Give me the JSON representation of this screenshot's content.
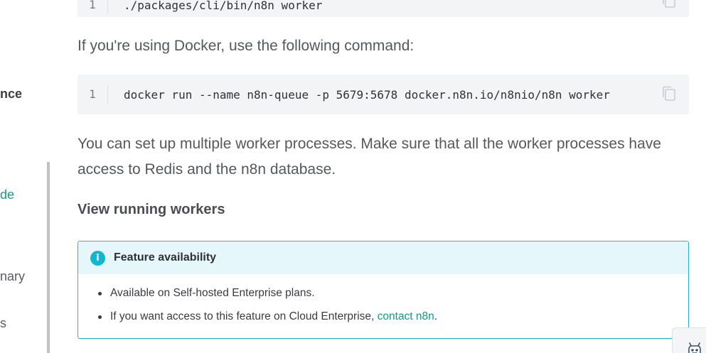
{
  "sidebar": {
    "frag_a": "nce",
    "frag_b": "de",
    "frag_c": "nary",
    "frag_d": "s"
  },
  "code_top": {
    "line_number": "1",
    "text": "./packages/cli/bin/n8n worker"
  },
  "docker_intro": "If you're using Docker, use the following command:",
  "code_main": {
    "line_number": "1",
    "text": "docker run --name n8n-queue -p 5679:5678 docker.n8n.io/n8nio/n8n worker"
  },
  "workers_para": "You can set up multiple worker processes. Make sure that all the worker processes have access to Redis and the n8n database.",
  "heading": "View running workers",
  "callout": {
    "title": "Feature availability",
    "items": [
      {
        "text": "Available on Self-hosted Enterprise plans."
      },
      {
        "text_before": "If you want access to this feature on Cloud Enterprise, ",
        "link": "contact n8n",
        "text_after": "."
      }
    ]
  },
  "icons": {
    "copy": "copy-icon",
    "info": "info-icon",
    "widget": "chat-widget-icon"
  },
  "colors": {
    "accent": "#119c83",
    "callout_border": "#26b5c9",
    "callout_bg": "#e5f7fa",
    "code_bg": "#f3f4f5"
  }
}
